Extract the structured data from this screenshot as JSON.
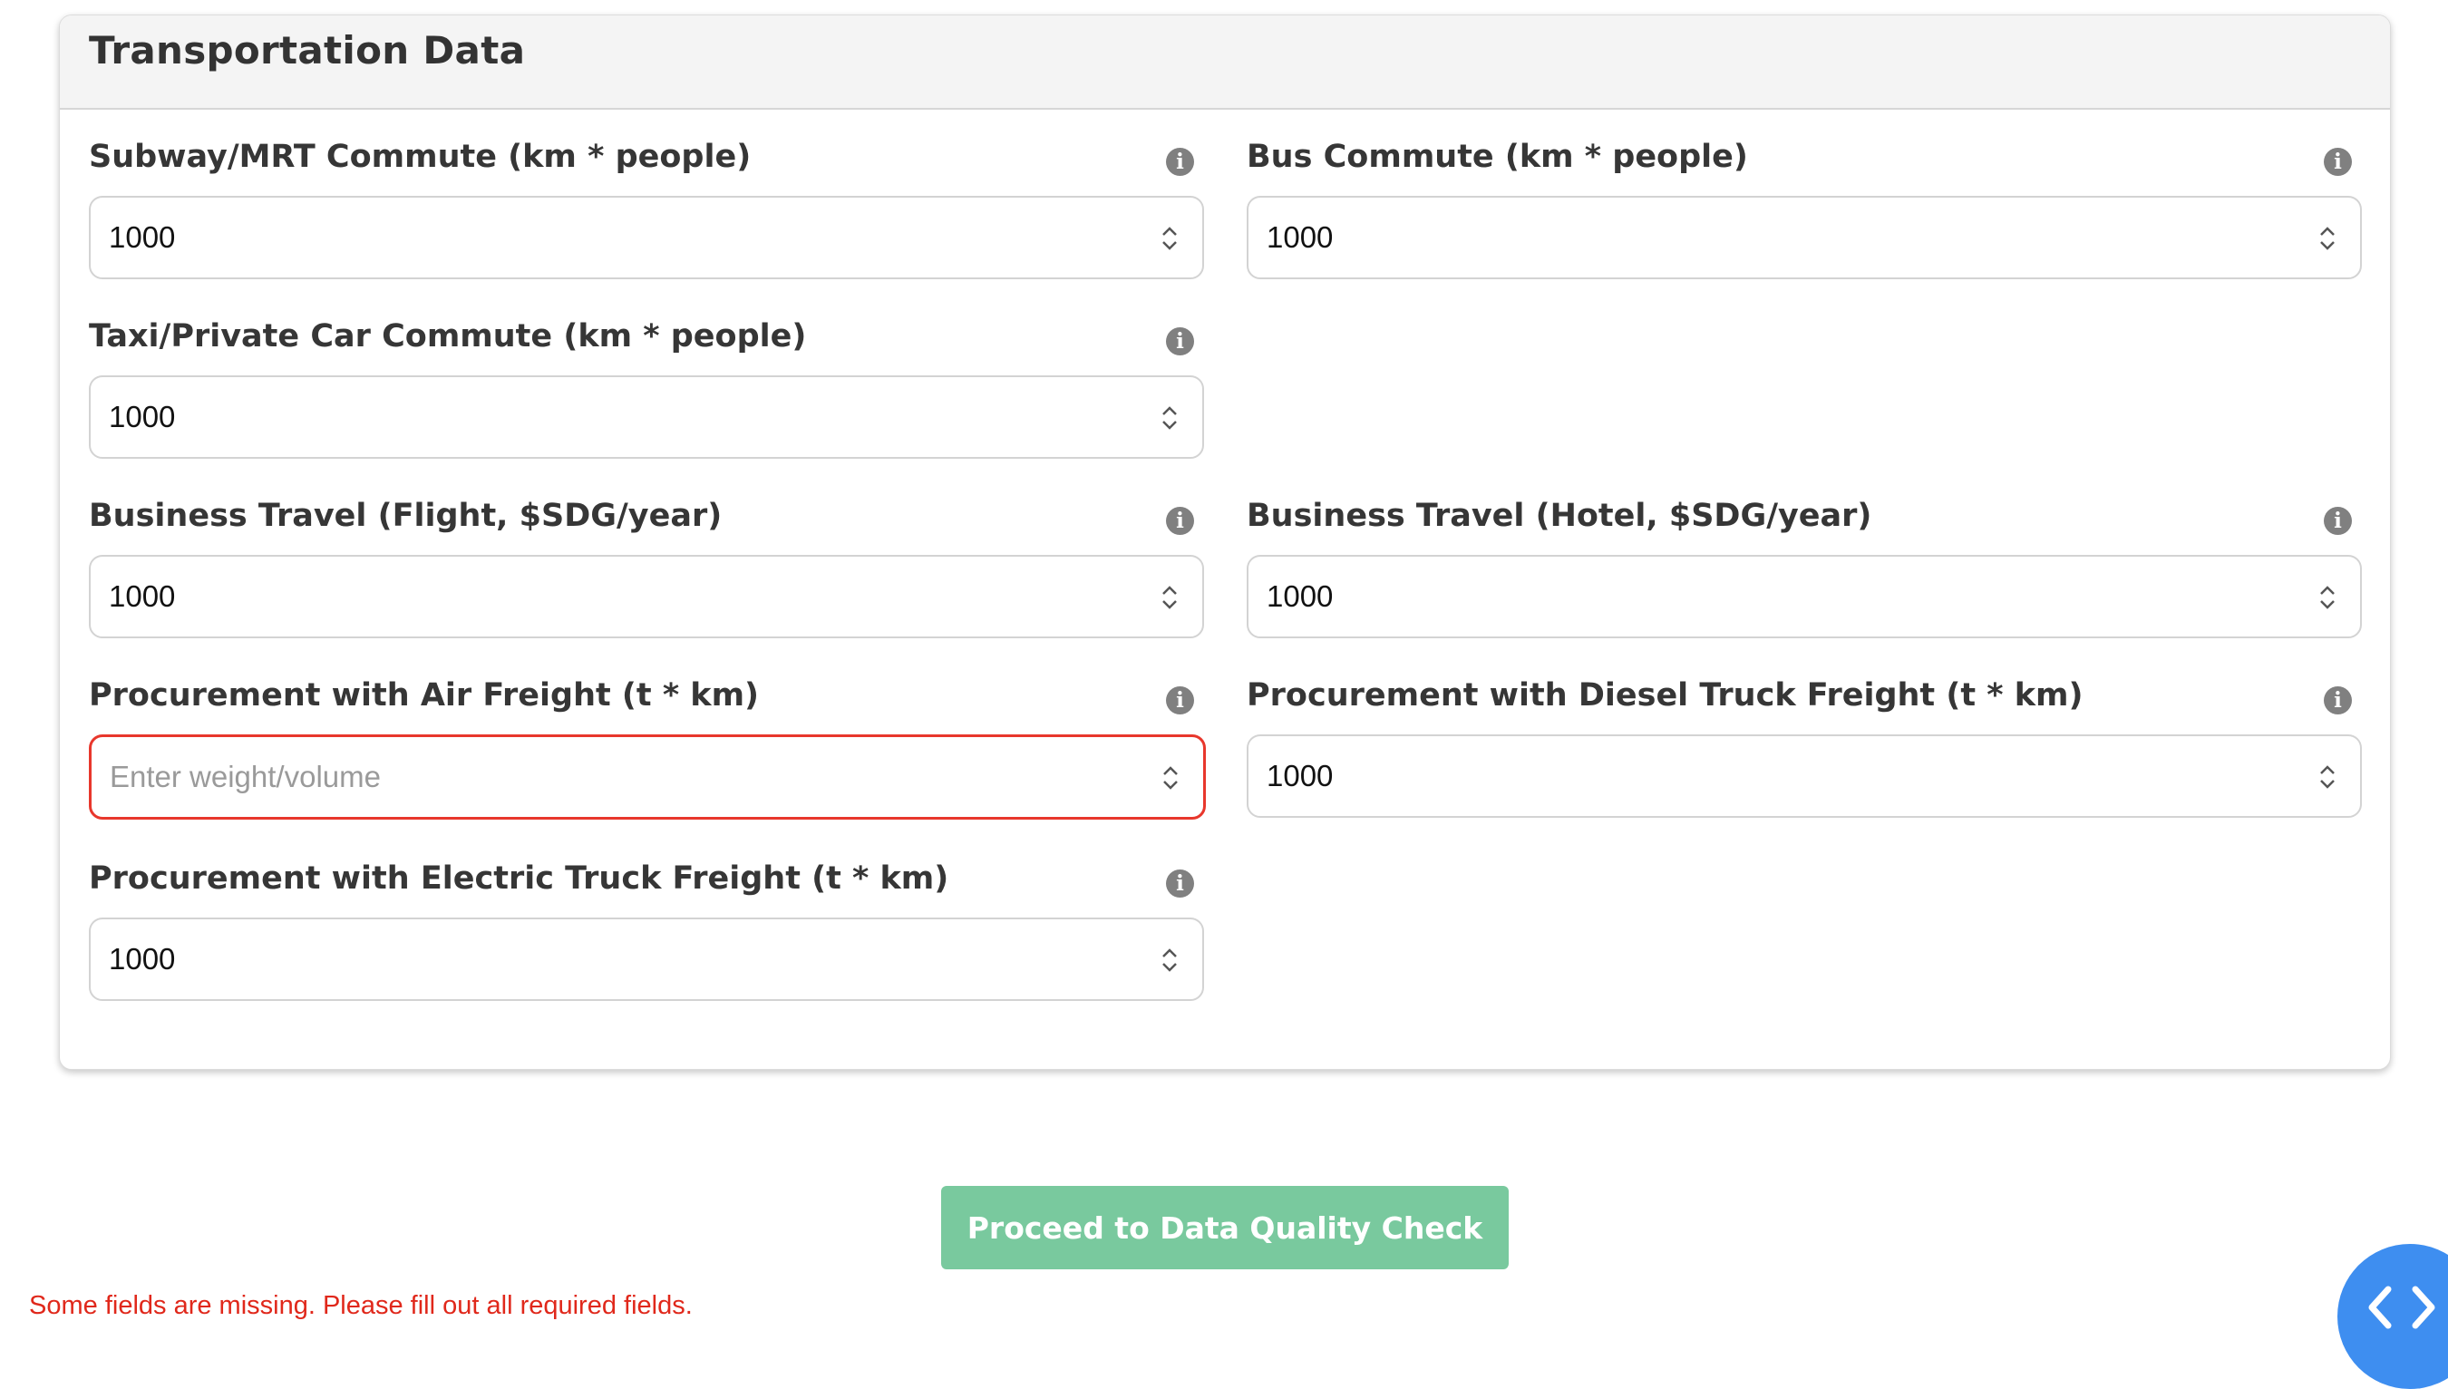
{
  "card": {
    "title": "Transportation Data"
  },
  "fields": {
    "subway": {
      "label": "Subway/MRT Commute (km * people)",
      "value": "1000",
      "placeholder": ""
    },
    "bus": {
      "label": "Bus Commute (km * people)",
      "value": "1000",
      "placeholder": ""
    },
    "taxi": {
      "label": "Taxi/Private Car Commute (km * people)",
      "value": "1000",
      "placeholder": ""
    },
    "flight": {
      "label": "Business Travel (Flight, $SDG/year)",
      "value": "1000",
      "placeholder": ""
    },
    "hotel": {
      "label": "Business Travel (Hotel, $SDG/year)",
      "value": "1000",
      "placeholder": ""
    },
    "air_freight": {
      "label": "Procurement with Air Freight (t * km)",
      "value": "",
      "placeholder": "Enter weight/volume",
      "error": true
    },
    "diesel_freight": {
      "label": "Procurement with Diesel Truck Freight (t * km)",
      "value": "1000",
      "placeholder": ""
    },
    "electric_freight": {
      "label": "Procurement with Electric Truck Freight (t * km)",
      "value": "1000",
      "placeholder": ""
    }
  },
  "info_icon_glyph": "i",
  "actions": {
    "proceed_label": "Proceed to Data Quality Check"
  },
  "validation": {
    "message": "Some fields are missing. Please fill out all required fields."
  },
  "colors": {
    "error": "#e8372c",
    "proceed_button": "#79c99e",
    "nav_button": "#3e8ef0",
    "info_icon": "#808080"
  },
  "icons": {
    "info": "info-icon",
    "stepper": "stepper-arrows-icon",
    "nav": "code-brackets-icon"
  }
}
